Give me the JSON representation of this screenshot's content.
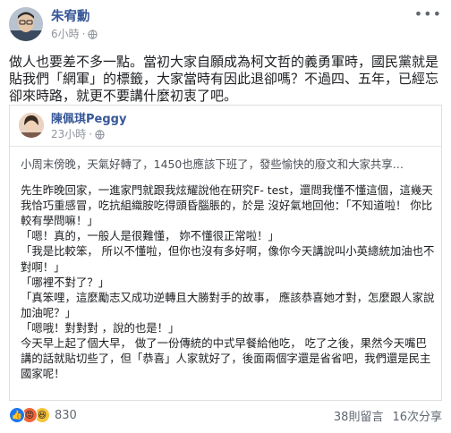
{
  "post": {
    "author": "朱宥勳",
    "time": "6小時",
    "text": "做人也要差不多一點。當初大家自願成為柯文哲的義勇軍時，國民黨就是貼我們「網軍」的標籤，大家當時有因此退卻嗎？不過四、五年，已經忘卻來時路，就更不要講什麼初衷了吧。"
  },
  "shared": {
    "author": "陳佩琪Peggy",
    "time": "23小時",
    "lines": [
      "小周末傍晚，天氣好轉了，1450也應該下班了，發些愉快的廢文和大家共享…",
      "先生昨晚回家，一進家門就跟我炫耀說他在研究F- test，還問我懂不懂這個，這幾天我恰巧重感冒，吃抗組織胺吃得頭昏腦脹的，於是 沒好氣地回他：「不知道啦！ 你比較有學問嘛！」",
      "「嗯！真的，一般人是很難懂， 妳不懂很正常啦！」",
      "「我是比較笨， 所以不懂啦，但你也沒有多好啊，像你今天講說叫小英總統加油也不對啊！」",
      "「哪裡不對了？」",
      "「真笨哩，這麼勵志又成功逆轉且大勝對手的故事， 應該恭喜她才對，怎麼跟人家說加油呢？」",
      "「嗯哦！對對對 ，說的也是！」",
      "今天早上起了個大早， 做了一份傳統的中式早餐給他吃， 吃了之後，果然今天嘴巴講的話就貼切些了，但「恭喜」人家就好了，後面兩個字還是省省吧，我們還是民主國家呢！"
    ]
  },
  "footer": {
    "reaction_count": "830",
    "comments": "38則留言",
    "shares": "16次分享"
  },
  "icons": {
    "globe": "globe-icon",
    "more": "more-options-icon",
    "like": "like-reaction-icon",
    "angry": "angry-reaction-icon",
    "haha": "haha-reaction-icon"
  },
  "colors": {
    "name_link": "#385898",
    "like_blue": "#1877f2",
    "angry_orange": "#f0653a",
    "haha_yellow": "#f7c33b"
  }
}
